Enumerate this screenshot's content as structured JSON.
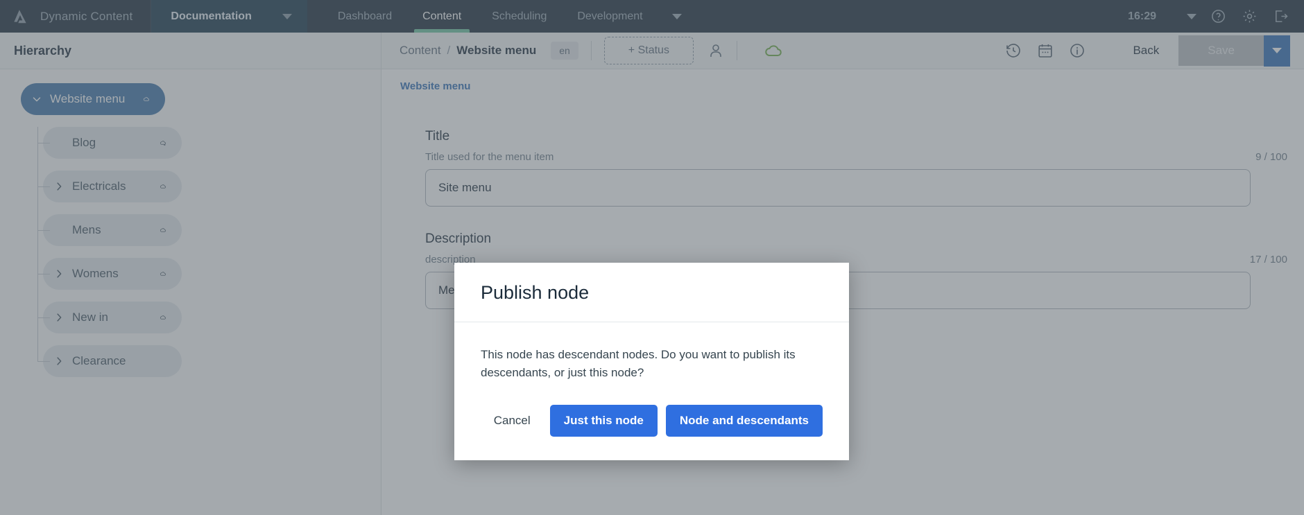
{
  "topnav": {
    "logo_icon": "amplience-logo-icon",
    "brand": "Dynamic Content",
    "hub": {
      "label": "Documentation",
      "caret_icon": "chevron-down-icon"
    },
    "tabs": [
      {
        "label": "Dashboard",
        "active": false
      },
      {
        "label": "Content",
        "active": true
      },
      {
        "label": "Scheduling",
        "active": false
      },
      {
        "label": "Development",
        "active": false
      }
    ],
    "more_caret_icon": "chevron-down-icon",
    "clock": "16:29",
    "clock_caret_icon": "chevron-down-icon",
    "icons": [
      "help-icon",
      "gear-icon",
      "logout-icon"
    ],
    "accent_active": "#6ac3a1",
    "background": "#1b2b3a"
  },
  "subheader": {
    "hierarchy_title": "Hierarchy",
    "breadcrumb": {
      "parent": "Content",
      "separator": "/",
      "current": "Website menu"
    },
    "locale": "en",
    "status_button": "+ Status",
    "user_icon": "user-icon",
    "published_cloud_icon": "cloud-icon",
    "published_color": "#70ad47",
    "icons": [
      "history-icon",
      "calendar-icon",
      "info-icon"
    ],
    "back_label": "Back",
    "save_label": "Save",
    "save_caret_icon": "chevron-down-icon",
    "save_caret_color": "#2f6eb5"
  },
  "tree": {
    "nodes": [
      {
        "label": "Website menu",
        "depth": 0,
        "selected": true,
        "chevron": "chevron-down-icon",
        "cloud": "cloud-icon"
      },
      {
        "label": "Blog",
        "depth": 1,
        "selected": false,
        "chevron": "none",
        "cloud": "cloud-x-icon"
      },
      {
        "label": "Electricals",
        "depth": 1,
        "selected": false,
        "chevron": "chevron-right-icon",
        "cloud": "cloud-icon"
      },
      {
        "label": "Mens",
        "depth": 1,
        "selected": false,
        "chevron": "none",
        "cloud": "cloud-icon"
      },
      {
        "label": "Womens",
        "depth": 1,
        "selected": false,
        "chevron": "chevron-right-icon",
        "cloud": "cloud-icon"
      },
      {
        "label": "New in",
        "depth": 1,
        "selected": false,
        "chevron": "chevron-right-icon",
        "cloud": "cloud-icon"
      },
      {
        "label": "Clearance",
        "depth": 1,
        "selected": false,
        "chevron": "chevron-right-icon",
        "cloud": "none"
      }
    ],
    "selected_color": "#3f74a8"
  },
  "form": {
    "tab_label": "Website menu",
    "title_field": {
      "label": "Title",
      "help": "Title used for the menu item",
      "counter": "9 / 100",
      "value": "Site menu",
      "placeholder": ""
    },
    "description_field": {
      "label": "Description",
      "help": "description",
      "counter": "17 / 100",
      "value": "Menu description",
      "placeholder": ""
    }
  },
  "modal": {
    "title": "Publish node",
    "body": "This node has descendant nodes. Do you want to publish its descendants, or just this node?",
    "cancel_label": "Cancel",
    "just_this_node_label": "Just this node",
    "node_and_descendants_label": "Node and descendants",
    "primary_color": "#2f6fe0"
  }
}
